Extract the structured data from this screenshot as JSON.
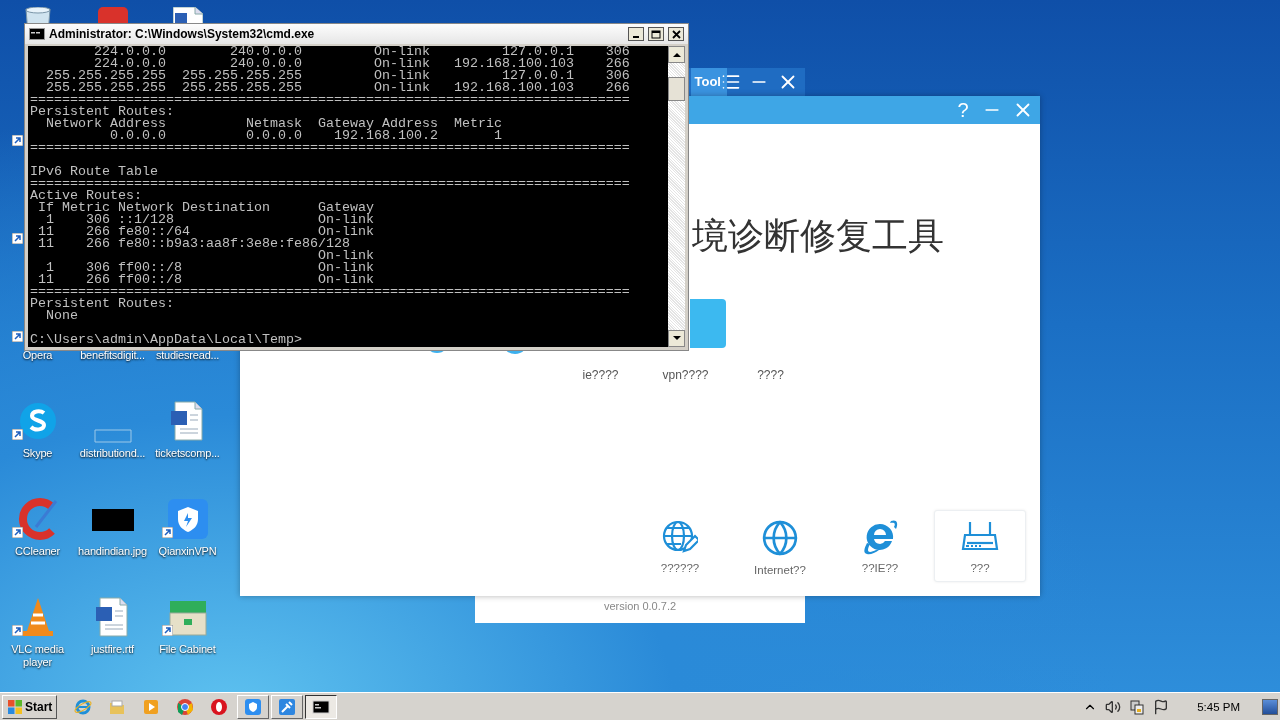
{
  "desktop_rows": [
    {
      "icons": [
        {
          "kind": "recycle"
        },
        {
          "kind": "app-tile"
        },
        {
          "kind": "document"
        }
      ]
    },
    {
      "icons": [
        {
          "shortcut": true
        }
      ]
    },
    {
      "icons": [
        {
          "shortcut": true
        }
      ]
    },
    {
      "icons": [
        {
          "label": "Opera",
          "shortcut": true
        },
        {
          "label": "benefitsdigit..."
        },
        {
          "label": "studiesread..."
        }
      ]
    },
    {
      "icons": [
        {
          "kind": "skype",
          "label": "Skype",
          "shortcut": true
        },
        {
          "kind": "blank",
          "label": "distributiond..."
        },
        {
          "kind": "word",
          "label": "ticketscomp..."
        }
      ]
    },
    {
      "icons": [
        {
          "kind": "ccleaner",
          "label": "CCleaner",
          "shortcut": true
        },
        {
          "kind": "image",
          "label": "handindian.jpg"
        },
        {
          "kind": "vpn",
          "label": "QianxinVPN",
          "shortcut": true
        }
      ]
    },
    {
      "icons": [
        {
          "kind": "vlc",
          "label": "VLC media player",
          "shortcut": true
        },
        {
          "kind": "word",
          "label": "justfire.rtf"
        },
        {
          "kind": "cabinet",
          "label": "File Cabinet",
          "shortcut": true
        }
      ]
    }
  ],
  "back_window": {
    "title": "Tool",
    "version": "version 0.0.7.2"
  },
  "main_window": {
    "help": "?",
    "heading": "境诊断修复工具",
    "options": [
      "ie????",
      "vpn????",
      "????"
    ],
    "tools": [
      {
        "kind": "globe-pencil",
        "label": "??????",
        "selected": false
      },
      {
        "kind": "globe",
        "label": "Internet??",
        "selected": false
      },
      {
        "kind": "ie",
        "label": "??IE??",
        "selected": false
      },
      {
        "kind": "router",
        "label": "???",
        "selected": true
      }
    ]
  },
  "console_window": {
    "title": "Administrator: C:\\Windows\\System32\\cmd.exe",
    "blocks": [
      [
        "        224.0.0.0        240.0.0.0         On-link         127.0.0.1    306",
        "        224.0.0.0        240.0.0.0         On-link   192.168.100.103    266",
        "  255.255.255.255  255.255.255.255         On-link         127.0.0.1    306",
        "  255.255.255.255  255.255.255.255         On-link   192.168.100.103    266",
        "===========================================================================",
        "Persistent Routes:",
        "  Network Address          Netmask  Gateway Address  Metric",
        "          0.0.0.0          0.0.0.0    192.168.100.2       1",
        "==========================================================================="
      ],
      [
        "IPv6 Route Table",
        "===========================================================================",
        "Active Routes:",
        " If Metric Network Destination      Gateway",
        "  1    306 ::1/128                  On-link",
        " 11    266 fe80::/64                On-link",
        " 11    266 fe80::b9a3:aa8f:3e8e:fe86/128",
        "                                    On-link",
        "  1    306 ff00::/8                 On-link",
        " 11    266 ff00::/8                 On-link",
        "===========================================================================",
        "Persistent Routes:",
        "  None"
      ],
      [
        "C:\\Users\\admin\\AppData\\Local\\Temp>"
      ]
    ]
  },
  "taskbar": {
    "start": "Start",
    "apps": [
      {
        "kind": "ie",
        "open": false,
        "selected": false
      },
      {
        "kind": "folder",
        "open": false,
        "selected": false
      },
      {
        "kind": "player",
        "open": false,
        "selected": false
      },
      {
        "kind": "chrome",
        "open": false,
        "selected": false
      },
      {
        "kind": "opera",
        "open": false,
        "selected": false
      },
      {
        "kind": "vpn",
        "open": true,
        "selected": false
      },
      {
        "kind": "tool",
        "open": true,
        "selected": false
      },
      {
        "kind": "console",
        "open": true,
        "selected": true
      }
    ],
    "clock": "5:45 PM"
  }
}
